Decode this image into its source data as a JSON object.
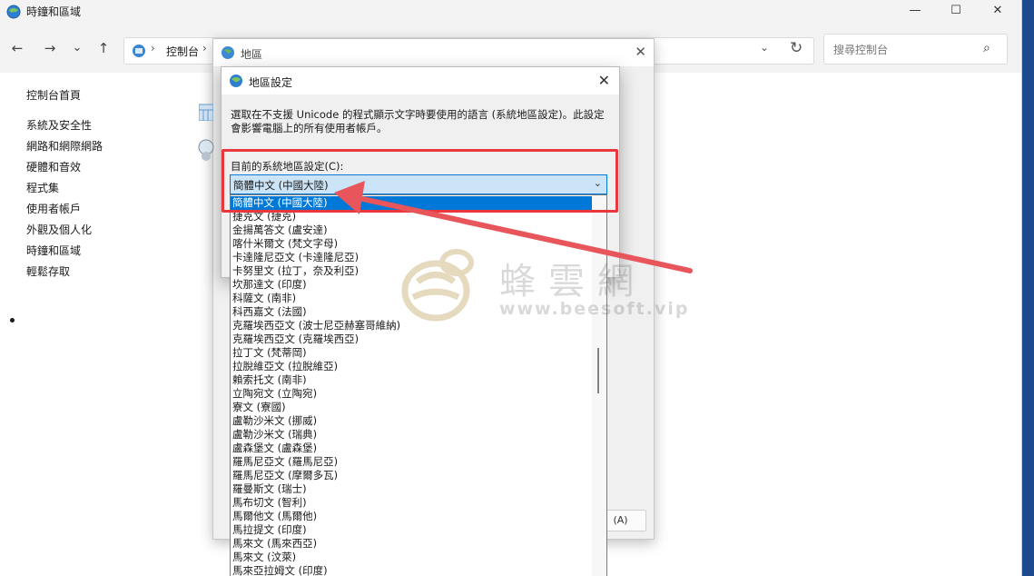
{
  "window": {
    "title": "時鐘和區域",
    "controls": {
      "minimize": "—",
      "maximize": "☐",
      "close": "✕"
    }
  },
  "nav": {
    "back": "←",
    "forward": "→",
    "recent": "⌄",
    "up": "↑",
    "breadcrumb": [
      "控制台"
    ],
    "refresh": "↻",
    "dropdown": "⌄",
    "search_placeholder": "搜尋控制台"
  },
  "sidebar": {
    "home": "控制台首頁",
    "items": [
      {
        "label": "系統及安全性",
        "active": false
      },
      {
        "label": "網路和網際網路",
        "active": false
      },
      {
        "label": "硬體和音效",
        "active": false
      },
      {
        "label": "程式集",
        "active": false
      },
      {
        "label": "使用者帳戶",
        "active": false
      },
      {
        "label": "外觀及個人化",
        "active": false
      },
      {
        "label": "時鐘和區域",
        "active": true
      },
      {
        "label": "輕鬆存取",
        "active": false
      }
    ]
  },
  "region_dialog": {
    "title": "地區",
    "close": "✕",
    "apply_button": "(A)"
  },
  "locale_dialog": {
    "title": "地區設定",
    "close": "✕",
    "description": "選取在不支援 Unicode 的程式顯示文字時要使用的語言 (系統地區設定)。此設定會影響電腦上的所有使用者帳戶。",
    "current_label": "目前的系統地區設定(C):",
    "current_value": "簡體中文 (中國大陸)",
    "options": [
      "簡體中文 (中國大陸)",
      "捷克文 (捷克)",
      "金揚萬答文 (盧安達)",
      "喀什米爾文 (梵文字母)",
      "卡達隆尼亞文 (卡達隆尼亞)",
      "卡努里文 (拉丁，奈及利亞)",
      "坎那達文 (印度)",
      "科薩文 (南非)",
      "科西嘉文 (法國)",
      "克羅埃西亞文 (波士尼亞赫塞哥維納)",
      "克羅埃西亞文 (克羅埃西亞)",
      "拉丁文 (梵蒂岡)",
      "拉脫維亞文 (拉脫維亞)",
      "賴索托文 (南非)",
      "立陶宛文 (立陶宛)",
      "寮文 (寮國)",
      "盧勒沙米文 (挪威)",
      "盧勒沙米文 (瑞典)",
      "盧森堡文 (盧森堡)",
      "羅馬尼亞文 (羅馬尼亞)",
      "羅馬尼亞文 (摩爾多瓦)",
      "羅曼斯文 (瑞士)",
      "馬布切文 (智利)",
      "馬爾他文 (馬爾他)",
      "馬拉提文 (印度)",
      "馬來文 (馬來西亞)",
      "馬來文 (汶萊)",
      "馬來亞拉姆文 (印度)"
    ]
  },
  "watermark": {
    "name": "蜂雲網",
    "url": "www.beesoft.vip"
  },
  "colors": {
    "highlight_border": "#e8383d",
    "selection": "#0078d7",
    "annotation_arrow": "#e8555a"
  }
}
